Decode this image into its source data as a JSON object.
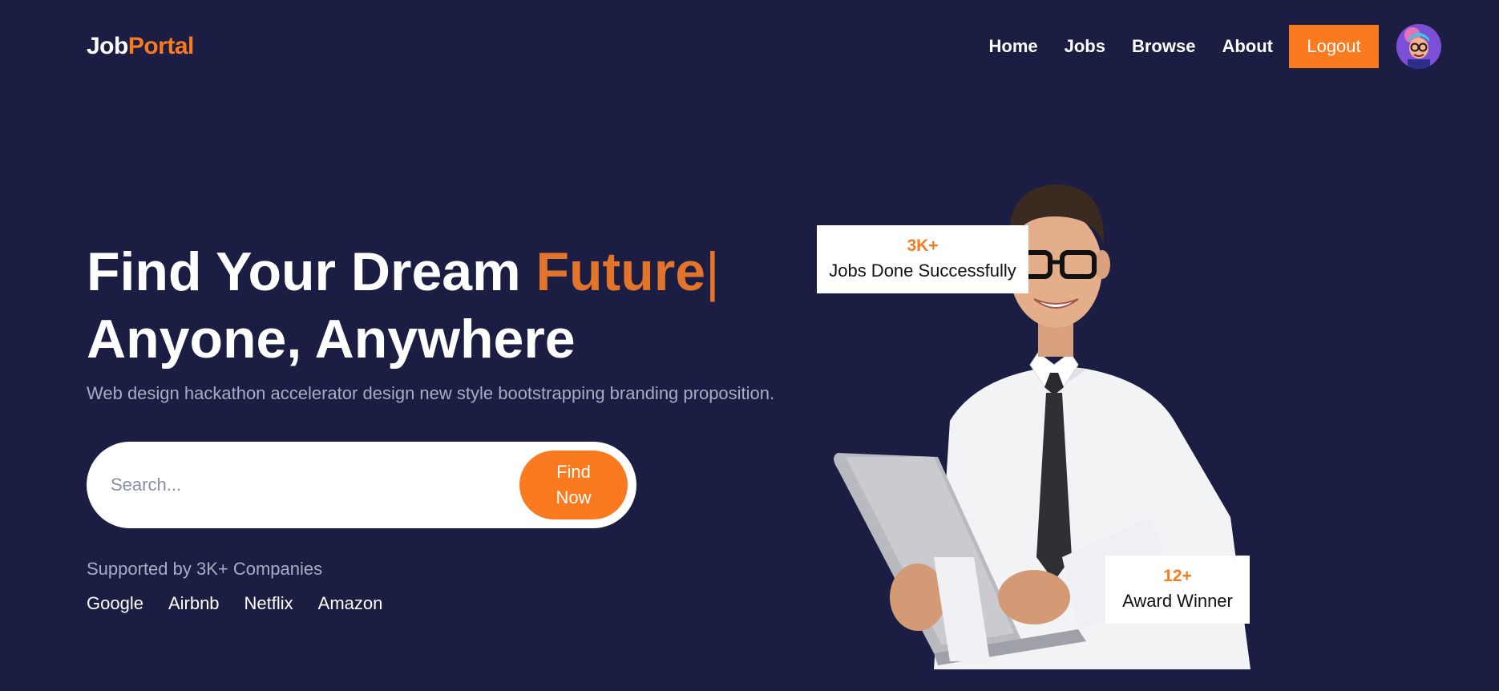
{
  "brand": {
    "name_part1": "Job",
    "name_part2": "Portal",
    "accent_color": "#f97a1f"
  },
  "nav": {
    "links": [
      "Home",
      "Jobs",
      "Browse",
      "About"
    ],
    "logout_label": "Logout",
    "avatar_icon": "avatar-icon"
  },
  "hero": {
    "title_line1_part1": "Find Your Dream ",
    "title_line1_accent": "Future",
    "title_caret": "|",
    "title_line2": "Anyone, Anywhere",
    "subtitle": "Web design hackathon accelerator design new style bootstrapping branding proposition."
  },
  "search": {
    "placeholder": "Search...",
    "button_label": "Find Now"
  },
  "supported": {
    "label": "Supported by 3K+ Companies",
    "companies": [
      "Google",
      "Airbnb",
      "Netflix",
      "Amazon"
    ]
  },
  "stats": {
    "jobs": {
      "number": "3K+",
      "label": "Jobs Done Successfully"
    },
    "awards": {
      "number": "12+",
      "label": "Award Winner"
    }
  },
  "colors": {
    "background": "#1c1d42",
    "accent": "#f97a1f",
    "muted_text": "#a9acc4"
  }
}
